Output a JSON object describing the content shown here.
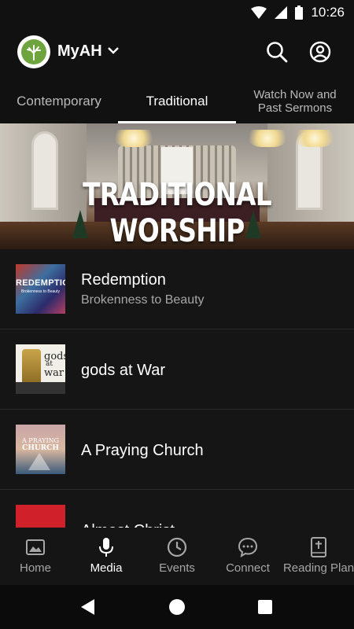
{
  "status_bar": {
    "time": "10:26",
    "icons": [
      "wifi-icon",
      "signal-icon",
      "battery-icon"
    ]
  },
  "app_bar": {
    "title": "MyAH",
    "icons": [
      "tree-logo-icon",
      "chevron-down-icon",
      "search-icon",
      "account-circle-icon"
    ]
  },
  "tabs": [
    {
      "label": "Contemporary",
      "selected": false
    },
    {
      "label": "Traditional",
      "selected": true
    },
    {
      "label": "Watch Now  and Past Sermons",
      "selected": false
    }
  ],
  "hero": {
    "title": "TRADITIONAL WORSHIP"
  },
  "series": [
    {
      "title": "Redemption",
      "subtitle": "Brokenness to Beauty",
      "thumb_text": [
        "REDEMPTION",
        "Brokenness to Beauty"
      ]
    },
    {
      "title": "gods at War",
      "subtitle": "",
      "thumb_text": [
        "gods",
        "at",
        "war"
      ]
    },
    {
      "title": "A Praying Church",
      "subtitle": "",
      "thumb_text": [
        "A PRAYING",
        "CHURCH"
      ]
    },
    {
      "title": "Almost Christ",
      "subtitle": "",
      "thumb_text": []
    }
  ],
  "bottom_nav": [
    {
      "label": "Home",
      "icon": "image-icon",
      "active": false
    },
    {
      "label": "Media",
      "icon": "microphone-icon",
      "active": true
    },
    {
      "label": "Events",
      "icon": "clock-icon",
      "active": false
    },
    {
      "label": "Connect",
      "icon": "chat-bubble-icon",
      "active": false
    },
    {
      "label": "Reading Plan",
      "icon": "bible-icon",
      "active": false
    }
  ],
  "colors": {
    "background": "#151515",
    "bar": "#111111",
    "accent": "#ffffff",
    "muted_text": "#a7a7a7",
    "logo_green": "#6ea43d"
  }
}
